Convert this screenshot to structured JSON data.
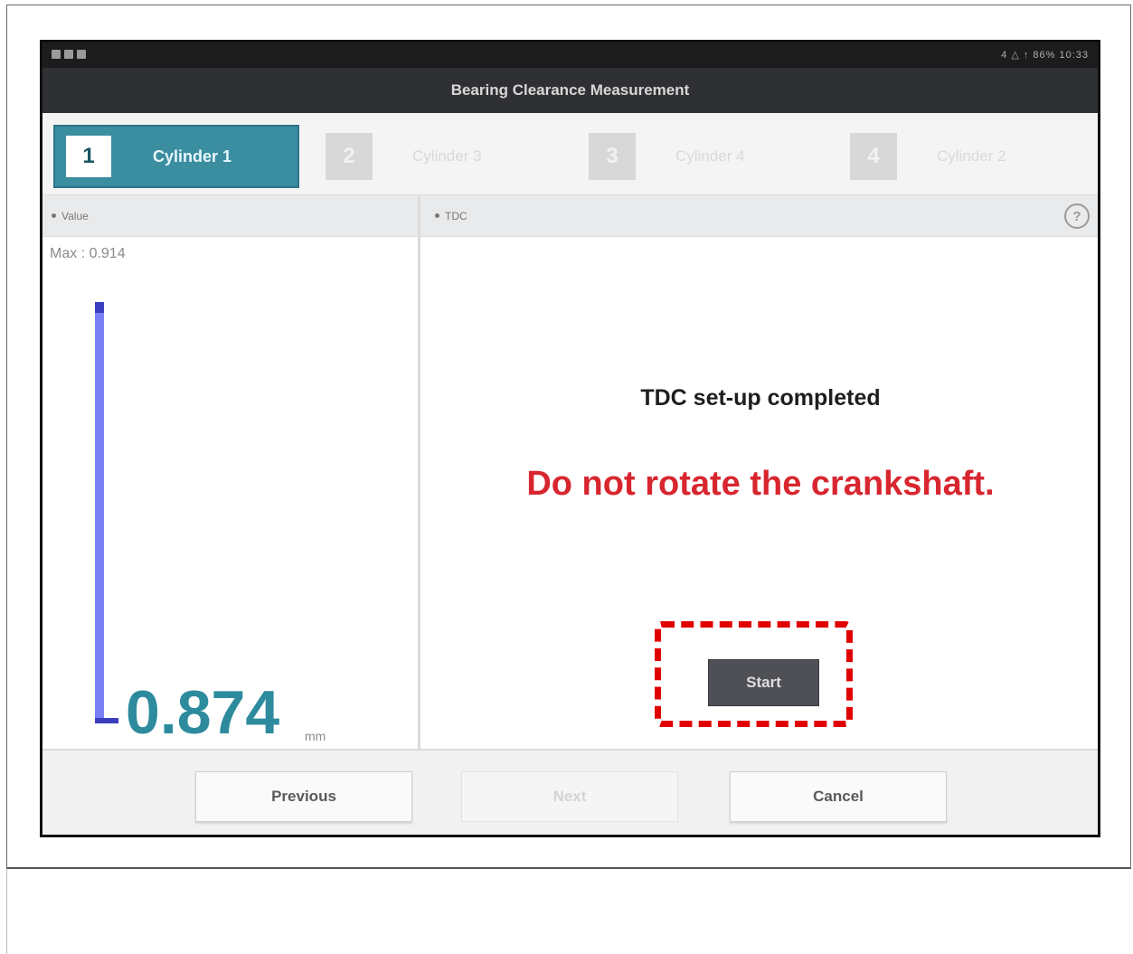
{
  "app": {
    "title": "Bearing Clearance Measurement"
  },
  "status_bar": {
    "right_text": "4 △ ↑ 86% 10:33"
  },
  "steps": [
    {
      "number": "1",
      "label": "Cylinder 1",
      "active": true
    },
    {
      "number": "2",
      "label": "Cylinder 3",
      "active": false
    },
    {
      "number": "3",
      "label": "Cylinder 4",
      "active": false
    },
    {
      "number": "4",
      "label": "Cylinder 2",
      "active": false
    }
  ],
  "left_panel": {
    "header": "Value",
    "max_label": "Max : 0.914",
    "value": "0.874",
    "unit": "mm",
    "gauge_color": "#7c7ef4"
  },
  "right_panel": {
    "header": "TDC",
    "help_icon": "question-circle-icon",
    "message": "TDC set-up completed",
    "warning": "Do not rotate the crankshaft.",
    "warning_color": "#d8262f",
    "start_label": "Start"
  },
  "footer": {
    "previous_label": "Previous",
    "next_label": "Next",
    "cancel_label": "Cancel"
  },
  "colors": {
    "accent": "#3b8da0",
    "highlight": "#e00000"
  }
}
